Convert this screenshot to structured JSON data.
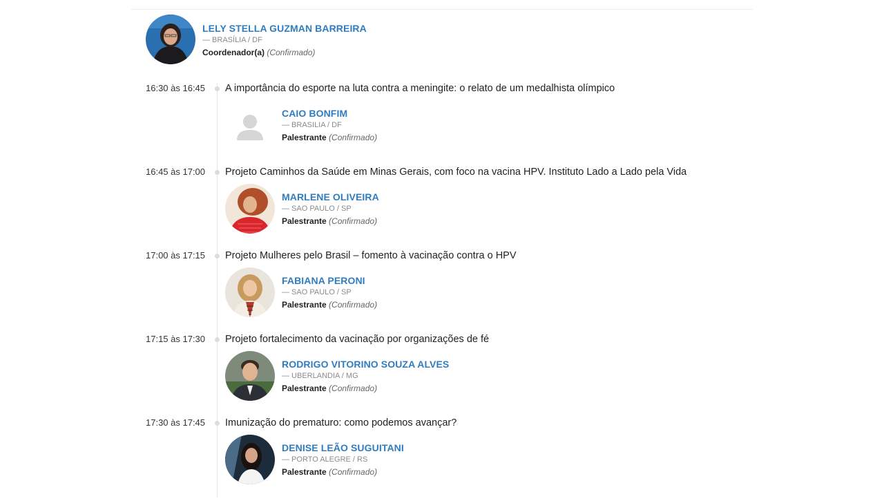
{
  "coordinator": {
    "name": "LELY STELLA GUZMAN BARREIRA",
    "location": "— BRASÍLIA / DF",
    "role": "Coordenador(a)",
    "status": "(Confirmado)"
  },
  "sessions": [
    {
      "time": "16:30 às 16:45",
      "title": "A importância do esporte na luta contra a meningite: o relato de um medalhista olímpico",
      "speaker": {
        "name": "CAIO BONFIM",
        "location": "— BRASILIA / DF",
        "role": "Palestrante",
        "status": "(Confirmado)"
      }
    },
    {
      "time": "16:45 às 17:00",
      "title": "Projeto Caminhos da Saúde em Minas Gerais, com foco na vacina HPV. Instituto Lado a Lado pela Vida",
      "speaker": {
        "name": "MARLENE OLIVEIRA",
        "location": "— SAO PAULO / SP",
        "role": "Palestrante",
        "status": "(Confirmado)"
      }
    },
    {
      "time": "17:00 às 17:15",
      "title": "Projeto Mulheres pelo Brasil – fomento à vacinação contra o HPV",
      "speaker": {
        "name": "FABIANA PERONI",
        "location": "— SAO PAULO / SP",
        "role": "Palestrante",
        "status": "(Confirmado)"
      }
    },
    {
      "time": "17:15 às 17:30",
      "title": "Projeto fortalecimento da vacinação por organizações de fé",
      "speaker": {
        "name": "RODRIGO VITORINO SOUZA ALVES",
        "location": "— UBERLANDIA / MG",
        "role": "Palestrante",
        "status": "(Confirmado)"
      }
    },
    {
      "time": "17:30 às 17:45",
      "title": "Imunização do prematuro: como podemos avançar?",
      "speaker": {
        "name": "DENISE LEÃO SUGUITANI",
        "location": "— PORTO ALEGRE / RS",
        "role": "Palestrante",
        "status": "(Confirmado)"
      }
    }
  ]
}
